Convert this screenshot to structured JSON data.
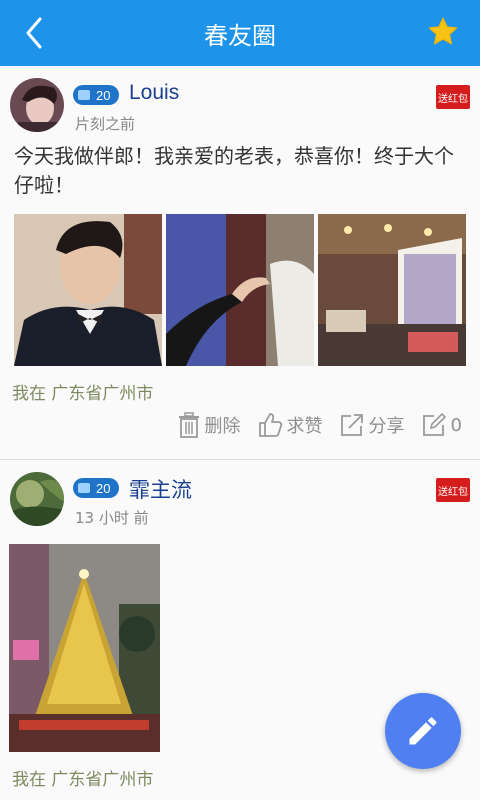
{
  "header": {
    "title": "春友圈",
    "back_icon": "chevron-left-icon",
    "favorite_icon": "star-icon"
  },
  "posts": [
    {
      "level": "20",
      "username": "Louis",
      "time": "片刻之前",
      "red_packet": "送红包",
      "content": "今天我做伴郎！我亲爱的老表，恭喜你！终于大个仔啦！",
      "location": "我在 广东省广州市",
      "actions": {
        "delete": "删除",
        "like": "求赞",
        "share": "分享",
        "comments": "0"
      }
    },
    {
      "level": "20",
      "username": "霏主流",
      "time": "13 小时 前",
      "red_packet": "送红包",
      "location": "我在 广东省广州市"
    }
  ],
  "colors": {
    "header": "#1e93ea",
    "fab": "#4f7ff0",
    "username": "#1b3f8f",
    "red_packet": "#d61d1d",
    "star": "#f7c213"
  }
}
